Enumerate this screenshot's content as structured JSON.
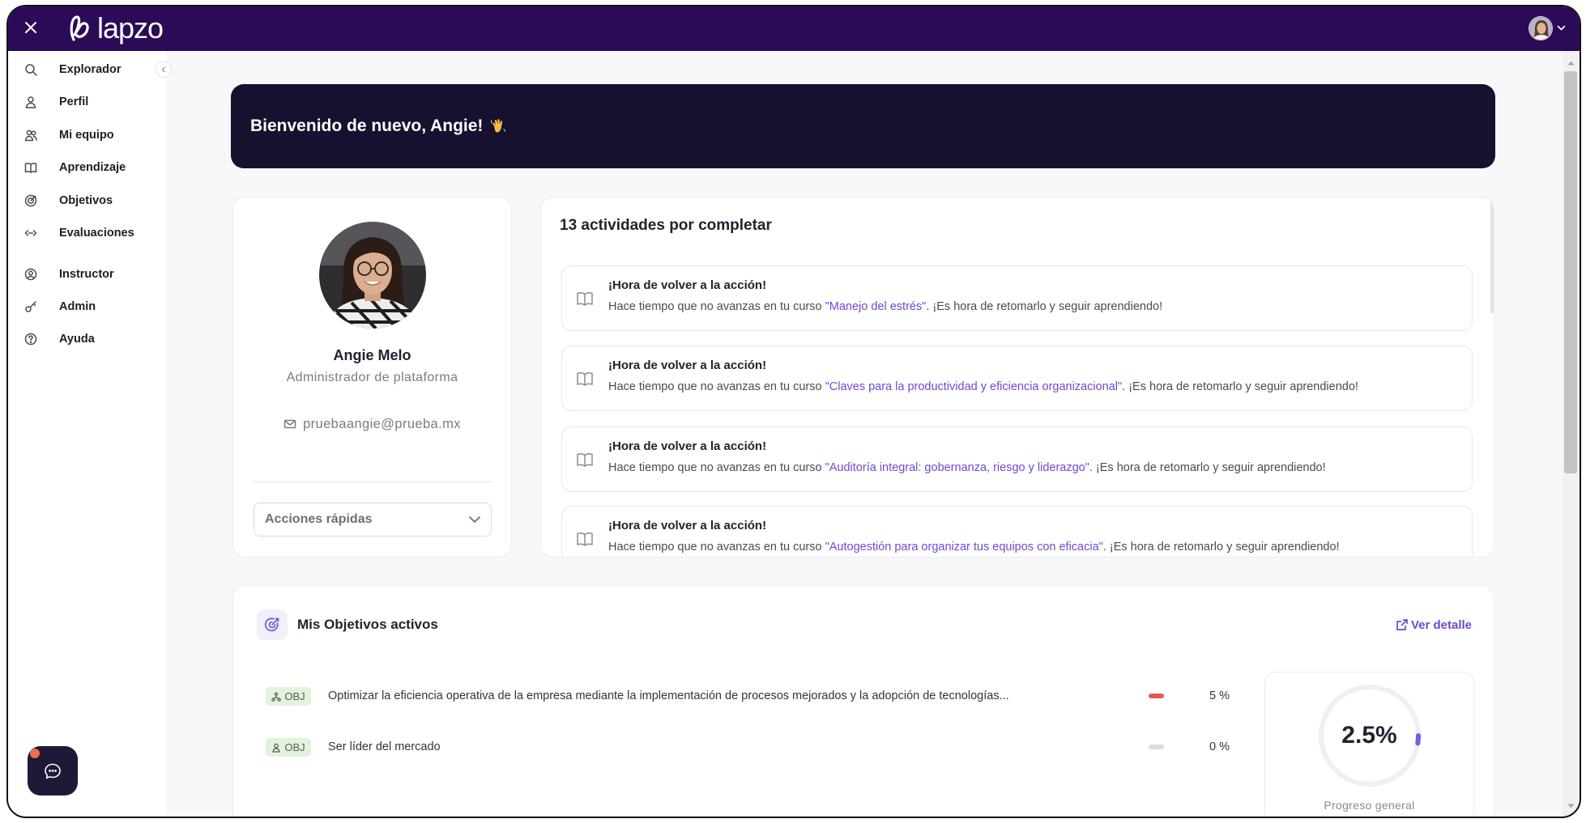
{
  "app": {
    "logo_text": "lapzo",
    "logo_icon": "lapzo-logo-mark",
    "close_icon": "close-icon",
    "user_avatar_icon": "user-avatar"
  },
  "sidebar": {
    "collapse_icon": "chevron-left-icon",
    "items": [
      {
        "label": "Explorador",
        "icon": "search-icon"
      },
      {
        "label": "Perfil",
        "icon": "user-icon"
      },
      {
        "label": "Mi equipo",
        "icon": "users-icon"
      },
      {
        "label": "Aprendizaje",
        "icon": "book-icon"
      },
      {
        "label": "Objetivos",
        "icon": "target-icon"
      },
      {
        "label": "Evaluaciones",
        "icon": "evaluations-icon"
      },
      {
        "label": "Instructor",
        "icon": "instructor-icon"
      },
      {
        "label": "Admin",
        "icon": "key-icon"
      },
      {
        "label": "Ayuda",
        "icon": "help-icon"
      }
    ]
  },
  "banner": {
    "greeting": "Bienvenido de nuevo, Angie!",
    "greeting_icon": "waving-hand-icon"
  },
  "profile": {
    "name": "Angie Melo",
    "role": "Administrador de plataforma",
    "email": "pruebaangie@prueba.mx",
    "quick_actions": "Acciones rápidas"
  },
  "activities": {
    "title": "13 actividades por completar",
    "items": [
      {
        "title": "¡Hora de volver a la acción!",
        "prefix": "Hace tiempo que no avanzas en tu curso ",
        "course": "\"Manejo del estrés\"",
        "suffix": ". ¡Es hora de retomarlo y seguir aprendiendo!"
      },
      {
        "title": "¡Hora de volver a la acción!",
        "prefix": "Hace tiempo que no avanzas en tu curso ",
        "course": "\"Claves para la productividad y eficiencia organizacional\"",
        "suffix": ". ¡Es hora de retomarlo y seguir aprendiendo!"
      },
      {
        "title": "¡Hora de volver a la acción!",
        "prefix": "Hace tiempo que no avanzas en tu curso ",
        "course": "\"Auditoría integral: gobernanza, riesgo y liderazgo\"",
        "suffix": ". ¡Es hora de retomarlo y seguir aprendiendo!"
      },
      {
        "title": "¡Hora de volver a la acción!",
        "prefix": "Hace tiempo que no avanzas en tu curso ",
        "course": "\"Autogestión para organizar tus equipos con eficacia\"",
        "suffix": ". ¡Es hora de retomarlo y seguir aprendiendo!"
      }
    ]
  },
  "objectives": {
    "title": "Mis Objetivos activos",
    "view_detail": "Ver detalle",
    "rows": [
      {
        "badge": "OBJ",
        "badge_icon": "hierarchy-icon",
        "text": "Optimizar la eficiencia operativa de la empresa mediante la implementación de procesos mejorados y la adopción de tecnologías...",
        "progress": 5,
        "progress_label": "5 %",
        "bar_color": "#e05a5a"
      },
      {
        "badge": "OBJ",
        "badge_icon": "user-icon",
        "text": "Ser líder del mercado",
        "progress": 0,
        "progress_label": "0 %",
        "bar_color": "#dcdce0"
      }
    ],
    "overall": {
      "value": 2.5,
      "label": "2.5%",
      "caption": "Progreso general"
    }
  },
  "colors": {
    "topbar": "#2b0a57",
    "banner": "#16112e",
    "accent": "#6a4bd4",
    "ring": "#7b5cdc",
    "main-bg": "#f8f8fa",
    "chat": "#1d1937",
    "chat-dot": "#f26b4b",
    "badge-bg": "#e4f2dc"
  }
}
